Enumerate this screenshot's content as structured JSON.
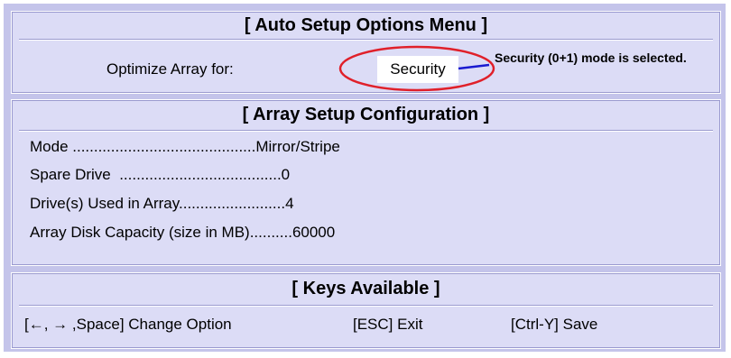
{
  "auto_setup": {
    "title": "[ Auto Setup Options Menu ]",
    "optimize_label": "Optimize Array for:",
    "optimize_value": "Security",
    "callout_text": "Security (0+1) mode is selected.",
    "highlight_color": "#e0202a",
    "pointer_color": "#1a1ad0"
  },
  "array_config": {
    "title": "[ Array Setup Configuration ]",
    "rows": [
      "Mode ...........................................Mirror/Stripe",
      "Spare Drive  ......................................0",
      "Drive(s) Used in Array.........................4",
      "Array Disk Capacity (size in MB)..........60000"
    ]
  },
  "keys": {
    "title": "[ Keys Available ]",
    "change_option": "[←, → ,Space] Change Option",
    "exit": "[ESC] Exit",
    "save": "[Ctrl-Y] Save"
  },
  "colors": {
    "outer_bg": "#c4c4ea",
    "panel_bg": "#dcdcf6"
  }
}
